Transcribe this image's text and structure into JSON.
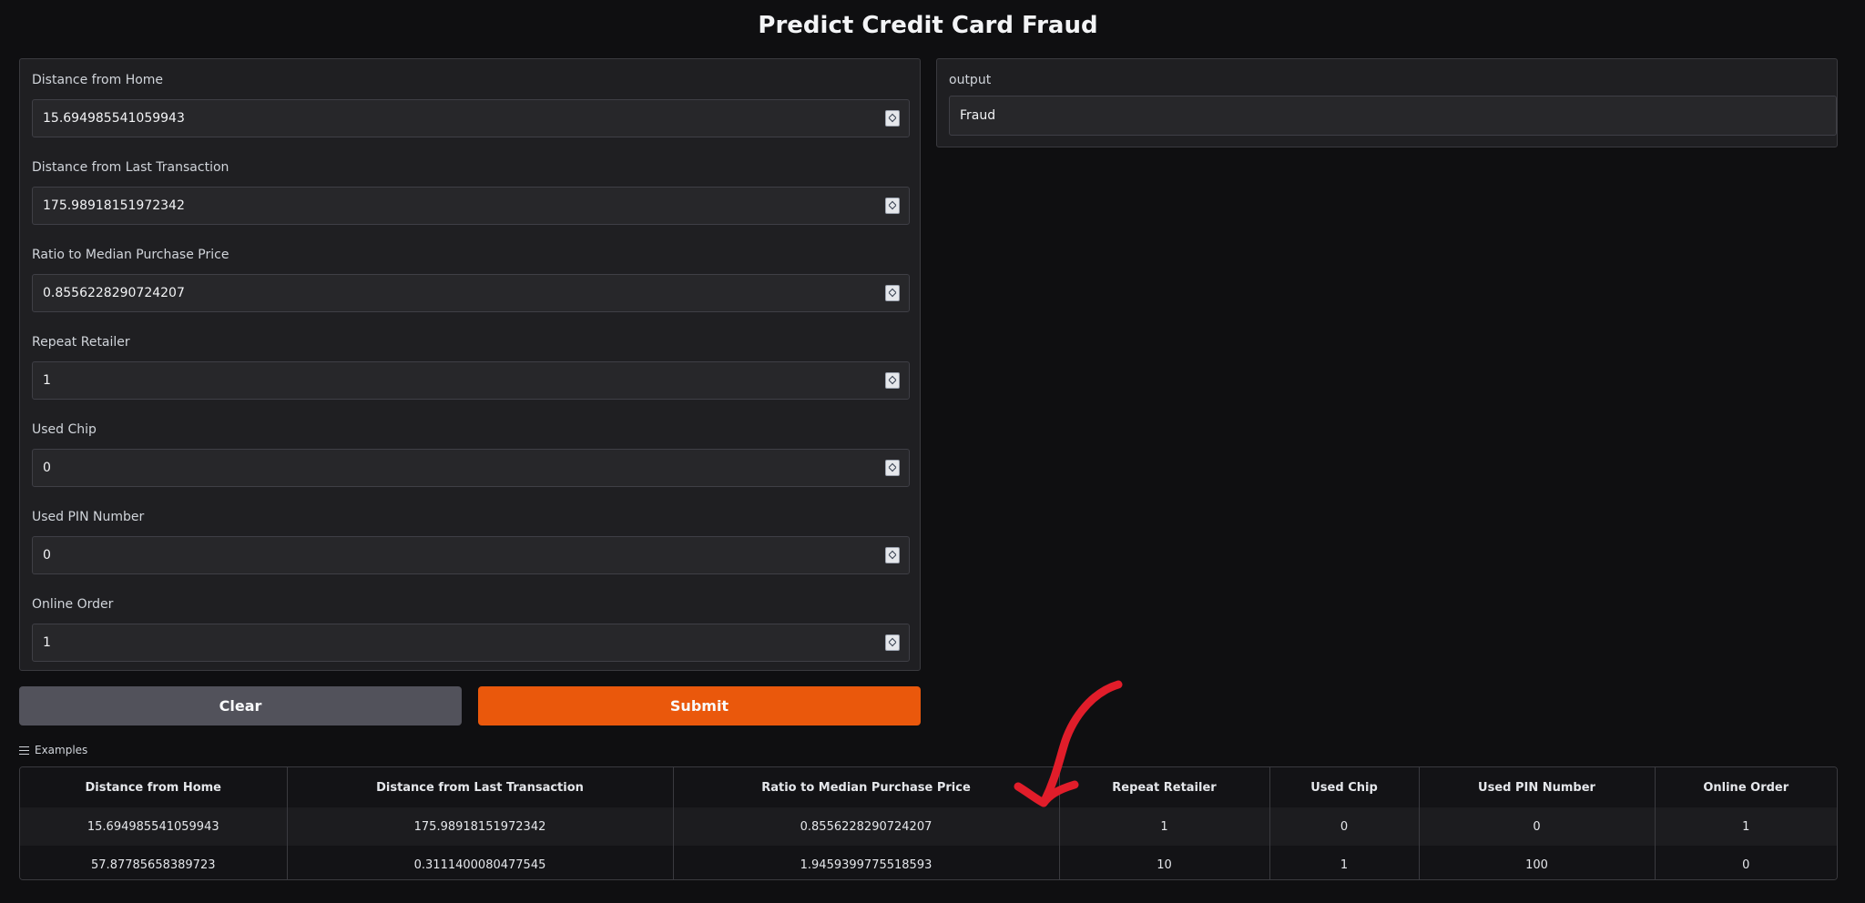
{
  "page": {
    "title": "Predict Credit Card Fraud"
  },
  "inputs": [
    {
      "label": "Distance from Home",
      "value": "15.694985541059943"
    },
    {
      "label": "Distance from Last Transaction",
      "value": "175.98918151972342"
    },
    {
      "label": "Ratio to Median Purchase Price",
      "value": "0.8556228290724207"
    },
    {
      "label": "Repeat Retailer",
      "value": "1"
    },
    {
      "label": "Used Chip",
      "value": "0"
    },
    {
      "label": "Used PIN Number",
      "value": "0"
    },
    {
      "label": "Online Order",
      "value": "1"
    }
  ],
  "output": {
    "label": "output",
    "value": "Fraud"
  },
  "buttons": {
    "clear": "Clear",
    "submit": "Submit"
  },
  "examples": {
    "label": "Examples",
    "headers": [
      "Distance from Home",
      "Distance from Last Transaction",
      "Ratio to Median Purchase Price",
      "Repeat Retailer",
      "Used Chip",
      "Used PIN Number",
      "Online Order"
    ],
    "rows": [
      [
        "15.694985541059943",
        "175.98918151972342",
        "0.8556228290724207",
        "1",
        "0",
        "0",
        "1"
      ],
      [
        "57.87785658389723",
        "0.3111400080477545",
        "1.9459399775518593",
        "10",
        "1",
        "100",
        "0"
      ]
    ]
  },
  "colors": {
    "background": "#0f0f11",
    "panel": "#1f1f22",
    "submit": "#ea580c",
    "clear": "#52525b",
    "annotation": "#e11d2a"
  }
}
